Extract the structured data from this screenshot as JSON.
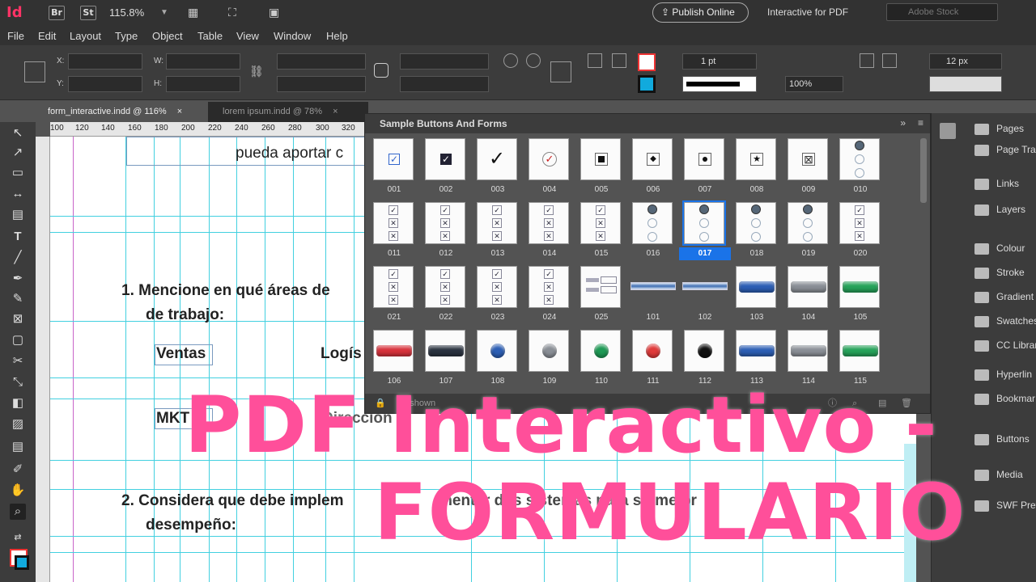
{
  "app": {
    "logo": "Id",
    "br": "Br",
    "st": "St",
    "zoom": "115.8%",
    "publish": "Publish Online",
    "workspace": "Interactive for PDF",
    "stock_placeholder": "Adobe Stock"
  },
  "menu": [
    "File",
    "Edit",
    "Layout",
    "Type",
    "Object",
    "Table",
    "View",
    "Window",
    "Help"
  ],
  "control": {
    "x": "X:",
    "y": "Y:",
    "w": "W:",
    "h": "H:",
    "stroke": "1 pt",
    "opacity": "100%",
    "size": "12 px"
  },
  "tabs": [
    {
      "label": "form_interactive.indd @ 116%",
      "close": "×"
    },
    {
      "label": "lorem ipsum.indd @ 78%",
      "close": "×"
    }
  ],
  "ruler": [
    "100",
    "120",
    "140",
    "160",
    "180",
    "200",
    "220",
    "240",
    "260",
    "280",
    "300",
    "320"
  ],
  "document": {
    "partial_line": "pueda aportar c",
    "q1a": "1.  Mencione en qué áreas de",
    "q1b": "de trabajo:",
    "ventas": "Ventas",
    "logis": "Logís",
    "mkt": "MKT",
    "direccion": "Direccion",
    "q2a": "2.  Considera que debe implem",
    "q2a_tail": "mentar dos sistemas para su mejor",
    "q2b": "desempeño:"
  },
  "panel": {
    "title": "Sample Buttons And Forms",
    "footer": "97 shown",
    "items": [
      {
        "id": "001",
        "kind": "check"
      },
      {
        "id": "002",
        "kind": "checkdark"
      },
      {
        "id": "003",
        "kind": "tick"
      },
      {
        "id": "004",
        "kind": "tickred"
      },
      {
        "id": "005",
        "kind": "square"
      },
      {
        "id": "006",
        "kind": "diamond"
      },
      {
        "id": "007",
        "kind": "dot"
      },
      {
        "id": "008",
        "kind": "star"
      },
      {
        "id": "009",
        "kind": "cross"
      },
      {
        "id": "010",
        "kind": "radio3"
      },
      {
        "id": "011",
        "kind": "stack3"
      },
      {
        "id": "012",
        "kind": "stack3"
      },
      {
        "id": "013",
        "kind": "stack3"
      },
      {
        "id": "014",
        "kind": "stack3"
      },
      {
        "id": "015",
        "kind": "stack3"
      },
      {
        "id": "016",
        "kind": "radio3"
      },
      {
        "id": "017",
        "kind": "radio3",
        "selected": true
      },
      {
        "id": "018",
        "kind": "radio3"
      },
      {
        "id": "019",
        "kind": "radio3"
      },
      {
        "id": "020",
        "kind": "stack3"
      },
      {
        "id": "021",
        "kind": "stack3"
      },
      {
        "id": "022",
        "kind": "stack3"
      },
      {
        "id": "023",
        "kind": "stack3"
      },
      {
        "id": "024",
        "kind": "stack3"
      },
      {
        "id": "025",
        "kind": "bars"
      },
      {
        "id": "101",
        "kind": "bar"
      },
      {
        "id": "102",
        "kind": "bar"
      },
      {
        "id": "103",
        "kind": "pillblue"
      },
      {
        "id": "104",
        "kind": "pillgray"
      },
      {
        "id": "105",
        "kind": "pillgreen"
      },
      {
        "id": "106",
        "kind": "pillred"
      },
      {
        "id": "107",
        "kind": "pilldark"
      },
      {
        "id": "108",
        "kind": "ballblue"
      },
      {
        "id": "109",
        "kind": "ballgray"
      },
      {
        "id": "110",
        "kind": "ballgreen"
      },
      {
        "id": "111",
        "kind": "ballred"
      },
      {
        "id": "112",
        "kind": "ballblack"
      },
      {
        "id": "113",
        "kind": "pillblue"
      },
      {
        "id": "114",
        "kind": "pillgray"
      },
      {
        "id": "115",
        "kind": "pillgreen"
      }
    ]
  },
  "right_panels": [
    "Pages",
    "Page Tra",
    "Links",
    "Layers",
    "Colour",
    "Stroke",
    "Gradient",
    "Swatches",
    "CC Librar",
    "Hyperlin",
    "Bookmar",
    "Buttons",
    "Media",
    "SWF Prev"
  ],
  "overlay": {
    "line1": "PDF Interactivo -",
    "line2": "FORMULARIO",
    "color": "#ff4f9a"
  }
}
